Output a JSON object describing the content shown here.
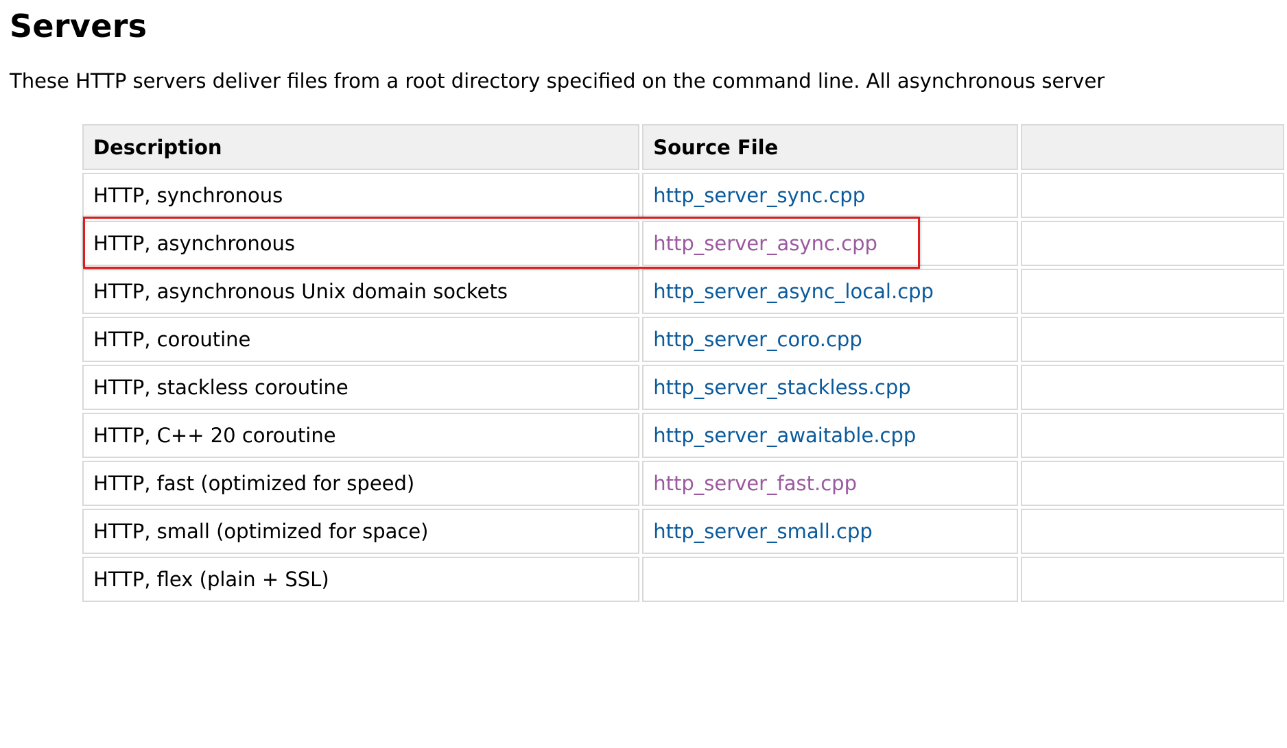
{
  "page": {
    "title": "Servers",
    "intro": "These HTTP servers deliver files from a root directory specified on the command line. All asynchronous server"
  },
  "table": {
    "headers": {
      "description": "Description",
      "source_file": "Source File"
    },
    "rows": [
      {
        "description": "HTTP, synchronous",
        "source_file": "http_server_sync.cpp",
        "visited": false
      },
      {
        "description": "HTTP, asynchronous",
        "source_file": "http_server_async.cpp",
        "visited": true,
        "highlighted": true
      },
      {
        "description": "HTTP, asynchronous Unix domain sockets",
        "source_file": "http_server_async_local.cpp",
        "visited": false
      },
      {
        "description": "HTTP, coroutine",
        "source_file": "http_server_coro.cpp",
        "visited": false
      },
      {
        "description": "HTTP, stackless coroutine",
        "source_file": "http_server_stackless.cpp",
        "visited": false
      },
      {
        "description": "HTTP, C++ 20 coroutine",
        "source_file": "http_server_awaitable.cpp",
        "visited": false
      },
      {
        "description": "HTTP, fast (optimized for speed)",
        "source_file": "http_server_fast.cpp",
        "visited": true
      },
      {
        "description": "HTTP, small (optimized for space)",
        "source_file": "http_server_small.cpp",
        "visited": false
      },
      {
        "description": "HTTP, flex (plain + SSL)",
        "source_file": "",
        "visited": false
      }
    ]
  },
  "colors": {
    "link": "#0a5a9c",
    "link_visited": "#9b59a0",
    "highlight_border": "#e01b1b",
    "header_bg": "#f0f0f0",
    "cell_border": "#d9d9d9"
  }
}
